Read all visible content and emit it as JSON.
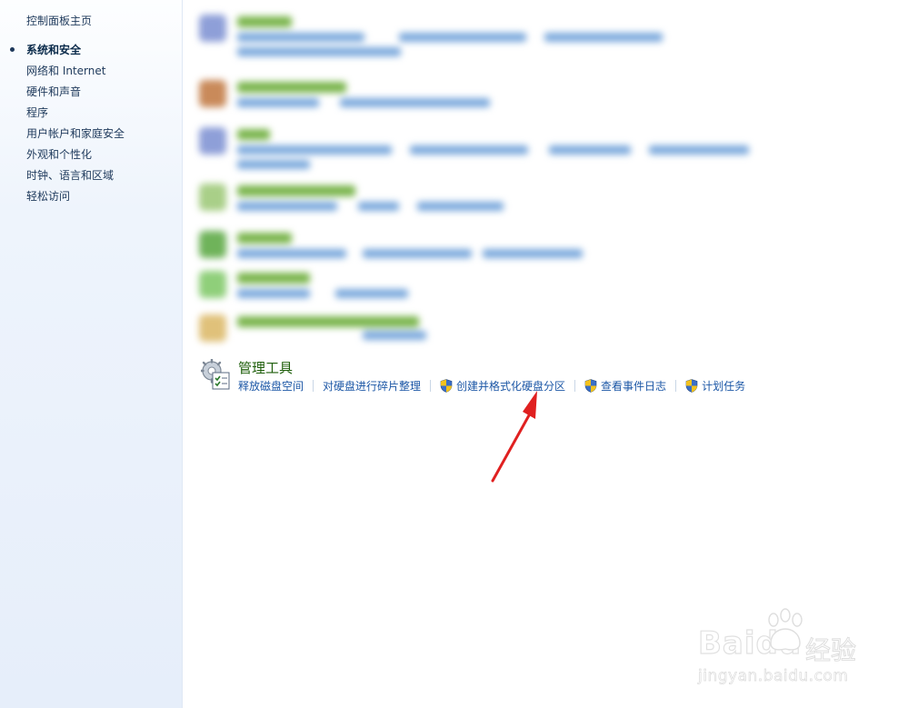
{
  "sidebar": {
    "home_link": "控制面板主页",
    "items": [
      {
        "label": "系统和安全",
        "current": true
      },
      {
        "label": "网络和 Internet"
      },
      {
        "label": "硬件和声音"
      },
      {
        "label": "程序"
      },
      {
        "label": "用户帐户和家庭安全"
      },
      {
        "label": "外观和个性化"
      },
      {
        "label": "时钟、语言和区域"
      },
      {
        "label": "轻松访问"
      }
    ]
  },
  "admin_tools": {
    "title": "管理工具",
    "links": [
      {
        "label": "释放磁盘空间",
        "shield": false
      },
      {
        "label": "对硬盘进行碎片整理",
        "shield": false
      },
      {
        "label": "创建并格式化硬盘分区",
        "shield": true
      },
      {
        "label": "查看事件日志",
        "shield": true
      },
      {
        "label": "计划任务",
        "shield": true
      }
    ]
  },
  "watermark": {
    "brand": "Bai",
    "brand_suffix": "du",
    "cn": "经验",
    "url": "jingyan.baidu.com"
  },
  "colors": {
    "link": "#1c57a6",
    "category_title": "#1e5e0a",
    "arrow": "#e02020",
    "sidebar_bg": "#e6eefa"
  },
  "icons": {
    "category": "admin-tools-icon",
    "uac": "uac-shield-icon",
    "annotation": "red-arrow-icon"
  }
}
